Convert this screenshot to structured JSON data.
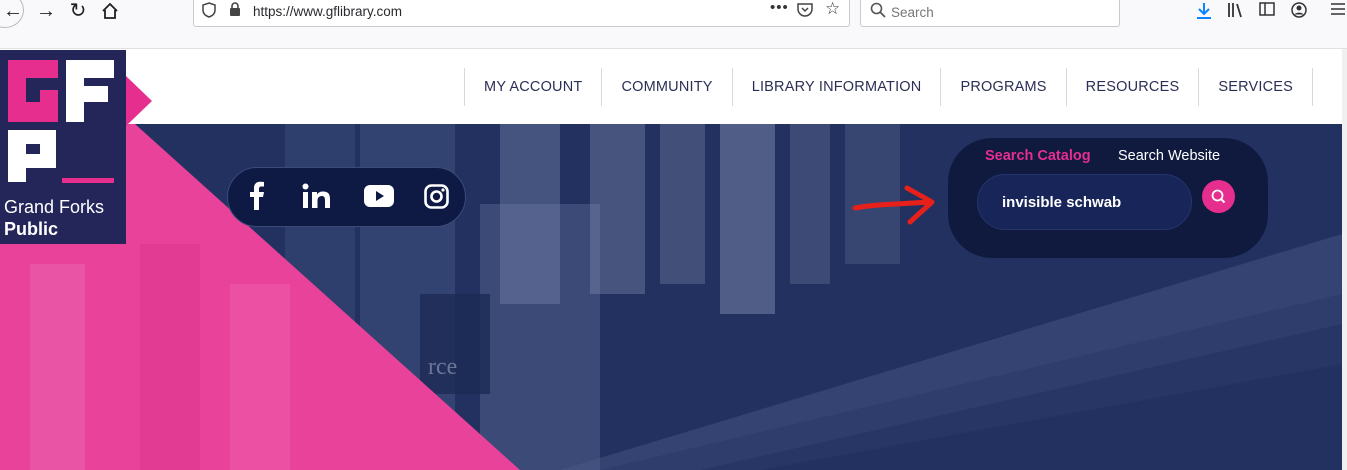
{
  "browser": {
    "url": "https://www.gflibrary.com",
    "search_placeholder": "Search",
    "icons": [
      "back-icon",
      "forward-icon",
      "reload-icon",
      "home-icon",
      "shield-icon",
      "lock-icon",
      "more-icon",
      "pocket-icon",
      "star-icon",
      "download-icon",
      "library-icon",
      "sidebar-icon",
      "account-icon",
      "menu-icon"
    ]
  },
  "nav": {
    "items": [
      "MY ACCOUNT",
      "COMMUNITY",
      "LIBRARY INFORMATION",
      "PROGRAMS",
      "RESOURCES",
      "SERVICES"
    ]
  },
  "logo": {
    "line1": "Grand Forks",
    "line2": "Public"
  },
  "social": {
    "icons": [
      "facebook-icon",
      "linkedin-icon",
      "youtube-icon",
      "instagram-icon"
    ]
  },
  "search": {
    "tab_catalog": "Search Catalog",
    "tab_website": "Search Website",
    "query": "invisible schwab"
  },
  "colors": {
    "brand_pink": "#e62e8f",
    "navy": "#24265a",
    "hero_blue": "#22315f",
    "search_bg": "#0f1a3e",
    "annotation_red": "#e8201a"
  }
}
